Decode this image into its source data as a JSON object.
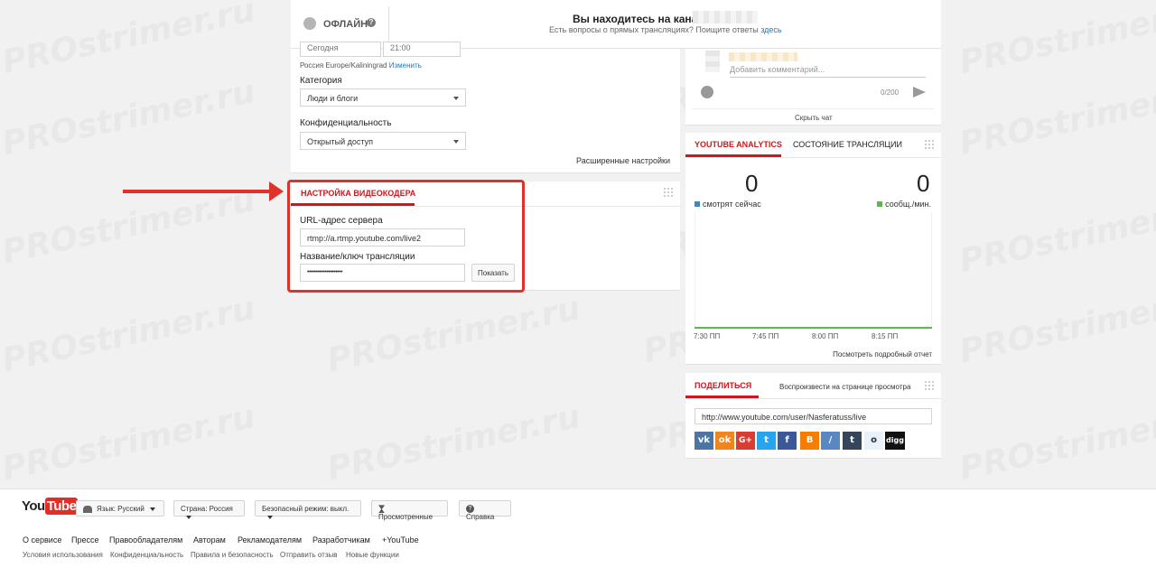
{
  "header": {
    "status": "ОФЛАЙН",
    "channel_text": "Вы находитесь на канале",
    "help_text": "Есть вопросы о прямых трансляциях? Поищите ответы",
    "help_link": "здесь"
  },
  "settings": {
    "date_value": "Сегодня",
    "time_value": "21:00",
    "timezone": "Россия Europe/Kaliningrad",
    "timezone_change": "Изменить",
    "category_label": "Категория",
    "category_value": "Люди и блоги",
    "privacy_label": "Конфиденциальность",
    "privacy_value": "Открытый доступ",
    "advanced_link": "Расширенные настройки"
  },
  "encoder": {
    "tab": "НАСТРОЙКА ВИДЕОКОДЕРА",
    "server_label": "URL-адрес сервера",
    "server_value": "rtmp://a.rtmp.youtube.com/live2",
    "key_label": "Название/ключ трансляции",
    "key_value": "••••••••••••••••••••",
    "show_button": "Показать"
  },
  "chat": {
    "placeholder": "Добавить комментарий...",
    "counter": "0/200",
    "hide_chat": "Скрыть чат"
  },
  "analytics": {
    "tab_active": "YOUTUBE ANALYTICS",
    "tab_inactive": "СОСТОЯНИЕ ТРАНСЛЯЦИИ",
    "viewers_value": "0",
    "viewers_label": "смотрят сейчас",
    "messages_value": "0",
    "messages_label": "сообщ./мин.",
    "ticks": [
      "7:30 ПП",
      "7:45 ПП",
      "8:00 ПП",
      "8:15 ПП"
    ],
    "report_link": "Посмотреть подробный отчет",
    "colors": {
      "viewers": "#3e87c8",
      "messages": "#5fb54f"
    }
  },
  "share": {
    "tab_active": "ПОДЕЛИТЬСЯ",
    "tab_inactive": "Воспроизвести на странице просмотра",
    "url": "http://www.youtube.com/user/Nasferatuss/live",
    "icons": [
      "vk-icon",
      "odnoklassniki-icon",
      "google-plus-icon",
      "twitter-icon",
      "facebook-icon",
      "blogger-icon",
      "livejournal-icon",
      "tumblr-icon",
      "reddit-icon",
      "digg-icon"
    ]
  },
  "footer": {
    "logo_you": "You",
    "logo_tube": "Tube",
    "language": "Язык: Русский",
    "country": "Страна: Россия",
    "safe_mode": "Безопасный режим: выкл.",
    "history": "Просмотренные",
    "help": "Справка",
    "links": [
      "О сервисе",
      "Прессе",
      "Правообладателям",
      "Авторам",
      "Рекламодателям",
      "Разработчикам",
      "+YouTube"
    ],
    "sublinks": [
      "Условия использования",
      "Конфиденциальность",
      "Правила и безопасность",
      "Отправить отзыв",
      "Новые функции"
    ]
  },
  "watermark": "PROstrimer.ru"
}
